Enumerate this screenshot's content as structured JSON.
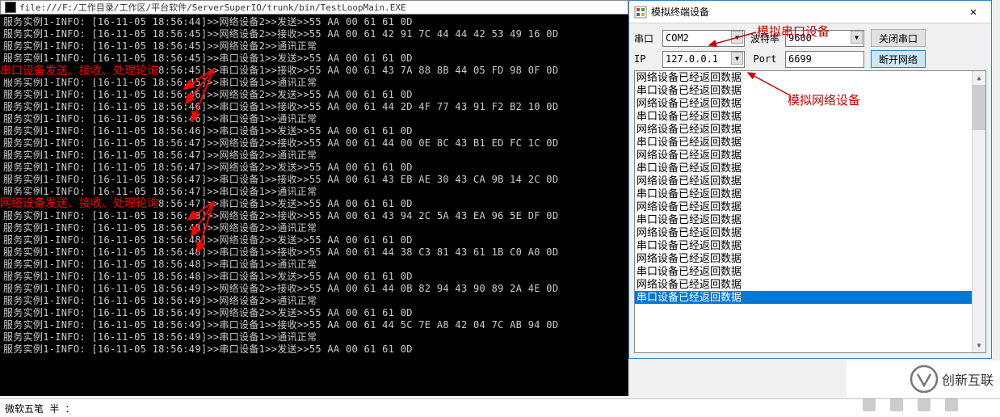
{
  "console": {
    "title": "file:///F:/工作目录/工作区/平台软件/ServerSuperIO/trunk/bin/TestLoopMain.EXE",
    "lines": [
      "服务实例1-INFO: [16-11-05 18:56:44]>>网络设备2>>发送>>55 AA 00 61 61 0D",
      "服务实例1-INFO: [16-11-05 18:56:45]>>网络设备2>>接收>>55 AA 00 61 42 91 7C 44 44 42 53 49 16 0D",
      "服务实例1-INFO: [16-11-05 18:56:45]>>网络设备2>>通讯正常",
      "服务实例1-INFO: [16-11-05 18:56:45]>>串口设备1>>发送>>55 AA 00 61 61 0D",
      "服务实例1-INFO: [16-11-05 18:56:45]>>串口设备1>>接收>>55 AA 00 61 43 7A 88 8B 44 05 FD 98 0F 0D",
      "服务实例1-INFO: [16-11-05 18:56:45]>>串口设备1>>通讯正常",
      "服务实例1-INFO: [16-11-05 18:56:46]>>网络设备2>>发送>>55 AA 00 61 61 0D",
      "服务实例1-INFO: [16-11-05 18:56:46]>>串口设备1>>接收>>55 AA 00 61 44 2D 4F 77 43 91 F2 B2 10 0D",
      "服务实例1-INFO: [16-11-05 18:56:46]>>串口设备1>>通讯正常",
      "服务实例1-INFO: [16-11-05 18:56:46]>>串口设备1>>发送>>55 AA 00 61 61 0D",
      "服务实例1-INFO: [16-11-05 18:56:47]>>网络设备2>>接收>>55 AA 00 61 44 00 0E 8C 43 B1 ED FC 1C 0D",
      "服务实例1-INFO: [16-11-05 18:56:47]>>网络设备2>>通讯正常",
      "服务实例1-INFO: [16-11-05 18:56:47]>>网络设备2>>发送>>55 AA 00 61 61 0D",
      "服务实例1-INFO: [16-11-05 18:56:47]>>串口设备1>>接收>>55 AA 00 61 43 EB AE 30 43 CA 9B 14 2C 0D",
      "服务实例1-INFO: [16-11-05 18:56:47]>>串口设备1>>通讯正常",
      "服务实例1-INFO: [16-11-05 18:56:47]>>串口设备1>>发送>>55 AA 00 61 61 0D",
      "服务实例1-INFO: [16-11-05 18:56:48]>>网络设备2>>接收>>55 AA 00 61 43 94 2C 5A 43 EA 96 5E DF 0D",
      "服务实例1-INFO: [16-11-05 18:56:48]>>网络设备2>>通讯正常",
      "服务实例1-INFO: [16-11-05 18:56:48]>>网络设备2>>发送>>55 AA 00 61 61 0D",
      "服务实例1-INFO: [16-11-05 18:56:48]>>串口设备1>>接收>>55 AA 00 61 44 38 C3 81 43 61 1B C0 A0 0D",
      "服务实例1-INFO: [16-11-05 18:56:48]>>串口设备1>>通讯正常",
      "服务实例1-INFO: [16-11-05 18:56:48]>>串口设备1>>发送>>55 AA 00 61 61 0D",
      "服务实例1-INFO: [16-11-05 18:56:49]>>网络设备2>>接收>>55 AA 00 61 44 0B 82 94 43 90 89 2A 4E 0D",
      "服务实例1-INFO: [16-11-05 18:56:49]>>网络设备2>>通讯正常",
      "服务实例1-INFO: [16-11-05 18:56:49]>>网络设备2>>发送>>55 AA 00 61 61 0D",
      "服务实例1-INFO: [16-11-05 18:56:49]>>串口设备1>>接收>>55 AA 00 61 44 5C 7E A8 42 04 7C AB 94 0D",
      "服务实例1-INFO: [16-11-05 18:56:49]>>串口设备1>>通讯正常",
      "服务实例1-INFO: [16-11-05 18:56:49]>>串口设备1>>发送>>55 AA 00 61 61 0D"
    ]
  },
  "overlays": {
    "t1": "串口设备发送、接收、处理轮询",
    "t2": "网络设备发送、接收、处理轮询"
  },
  "dialog": {
    "title": "模拟终端设备",
    "serial_label": "串口",
    "serial_value": "COM2",
    "baud_label": "波特率",
    "baud_value": "9600",
    "btn_close_serial": "关闭串口",
    "ip_label": "IP",
    "ip_value": "127.0.0.1",
    "port_label": "Port",
    "port_value": "6699",
    "btn_disconnect": "断开网络",
    "anno_serial": "模拟串口设备",
    "anno_network": "模拟网络设备",
    "list_items": [
      "网络设备已经返回数据",
      "串口设备已经返回数据",
      "网络设备已经返回数据",
      "串口设备已经返回数据",
      "网络设备已经返回数据",
      "串口设备已经返回数据",
      "网络设备已经返回数据",
      "串口设备已经返回数据",
      "网络设备已经返回数据",
      "串口设备已经返回数据",
      "网络设备已经返回数据",
      "串口设备已经返回数据",
      "网络设备已经返回数据",
      "串口设备已经返回数据",
      "网络设备已经返回数据",
      "串口设备已经返回数据",
      "网络设备已经返回数据",
      "串口设备已经返回数据"
    ]
  },
  "statusbar": {
    "text": "微软五笔 半 ：",
    "logo_text": "创新互联"
  }
}
